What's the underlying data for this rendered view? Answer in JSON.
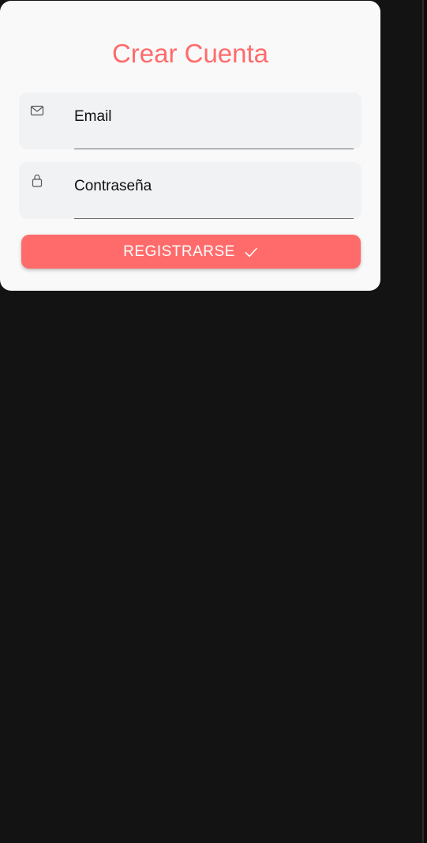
{
  "form": {
    "title": "Crear Cuenta",
    "email_label": "Email",
    "password_label": "Contraseña",
    "submit_label": "REGISTRARSE",
    "email_icon": "envelope-icon",
    "password_icon": "lock-icon",
    "submit_icon": "checkmark-icon"
  },
  "colors": {
    "accent": "#ff6b6b",
    "card_background": "#f9f9f9",
    "field_background": "#f1f2f4",
    "page_background": "#131313"
  }
}
